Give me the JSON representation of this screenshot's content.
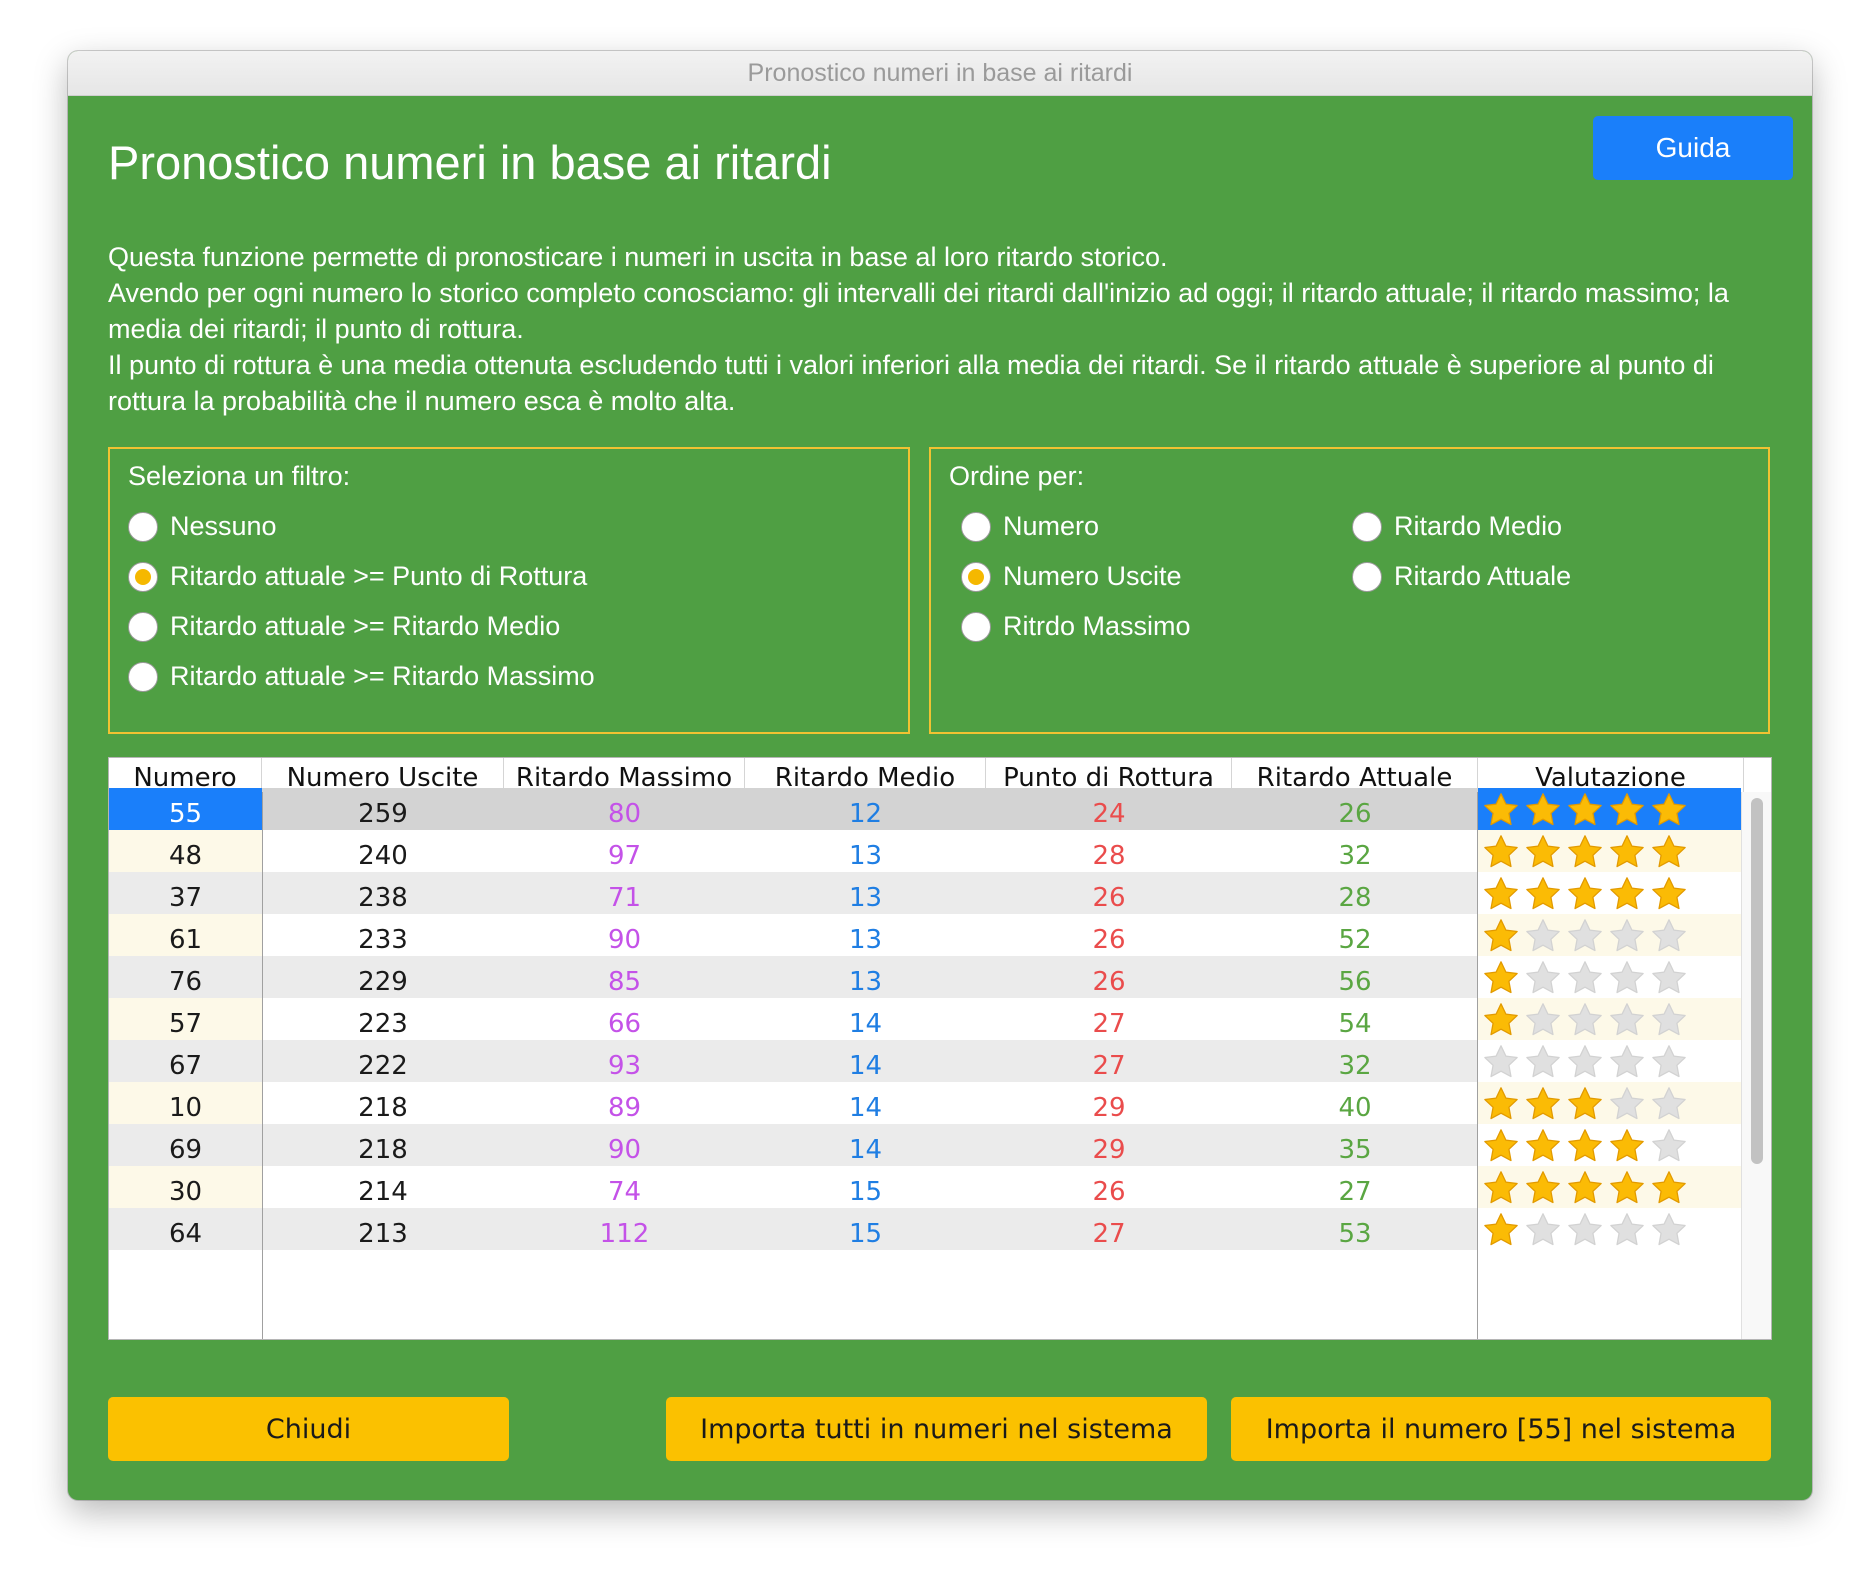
{
  "window": {
    "title": "Pronostico numeri in base ai ritardi"
  },
  "heading": "Pronostico numeri in base ai ritardi",
  "help_button": "Guida",
  "description": [
    "Questa funzione permette di pronosticare i numeri in uscita in base al loro ritardo storico.",
    "Avendo per ogni numero lo storico completo conosciamo: gli intervalli dei ritardi dall'inizio ad oggi; il ritardo attuale; il ritardo massimo; la media dei ritardi; il punto di rottura.",
    "Il punto di rottura è una media ottenuta escludendo tutti i valori inferiori alla media dei ritardi. Se il ritardo attuale è superiore al punto di rottura la probabilità che il numero esca è molto alta."
  ],
  "filter": {
    "title": "Seleziona un filtro:",
    "options": [
      {
        "label": "Nessuno",
        "selected": false
      },
      {
        "label": "Ritardo attuale >= Punto di Rottura",
        "selected": true
      },
      {
        "label": "Ritardo attuale >= Ritardo Medio",
        "selected": false
      },
      {
        "label": "Ritardo attuale >= Ritardo Massimo",
        "selected": false
      }
    ]
  },
  "order": {
    "title": "Ordine per:",
    "options": [
      {
        "label": "Numero",
        "selected": false
      },
      {
        "label": "Numero Uscite",
        "selected": true
      },
      {
        "label": "Ritrdo Massimo",
        "selected": false
      },
      {
        "label": "Ritardo Medio",
        "selected": false
      },
      {
        "label": "Ritardo Attuale",
        "selected": false
      }
    ]
  },
  "table": {
    "columns": [
      "Numero",
      "Numero Uscite",
      "Ritardo Massimo",
      "Ritardo Medio",
      "Punto di Rottura",
      "Ritardo Attuale",
      "Valutazione"
    ],
    "selected_row": 0,
    "rating_max": 5,
    "rows": [
      {
        "numero": "55",
        "uscite": "259",
        "massimo": "80",
        "medio": "12",
        "rottura": "24",
        "attuale": "26",
        "rating": 5
      },
      {
        "numero": "48",
        "uscite": "240",
        "massimo": "97",
        "medio": "13",
        "rottura": "28",
        "attuale": "32",
        "rating": 5
      },
      {
        "numero": "37",
        "uscite": "238",
        "massimo": "71",
        "medio": "13",
        "rottura": "26",
        "attuale": "28",
        "rating": 5
      },
      {
        "numero": "61",
        "uscite": "233",
        "massimo": "90",
        "medio": "13",
        "rottura": "26",
        "attuale": "52",
        "rating": 1
      },
      {
        "numero": "76",
        "uscite": "229",
        "massimo": "85",
        "medio": "13",
        "rottura": "26",
        "attuale": "56",
        "rating": 1
      },
      {
        "numero": "57",
        "uscite": "223",
        "massimo": "66",
        "medio": "14",
        "rottura": "27",
        "attuale": "54",
        "rating": 1
      },
      {
        "numero": "67",
        "uscite": "222",
        "massimo": "93",
        "medio": "14",
        "rottura": "27",
        "attuale": "32",
        "rating": 0
      },
      {
        "numero": "10",
        "uscite": "218",
        "massimo": "89",
        "medio": "14",
        "rottura": "29",
        "attuale": "40",
        "rating": 3
      },
      {
        "numero": "69",
        "uscite": "218",
        "massimo": "90",
        "medio": "14",
        "rottura": "29",
        "attuale": "35",
        "rating": 4
      },
      {
        "numero": "30",
        "uscite": "214",
        "massimo": "74",
        "medio": "15",
        "rottura": "26",
        "attuale": "27",
        "rating": 5
      },
      {
        "numero": "64",
        "uscite": "213",
        "massimo": "112",
        "medio": "15",
        "rottura": "27",
        "attuale": "53",
        "rating": 1
      }
    ]
  },
  "buttons": {
    "close": "Chiudi",
    "import_all": "Importa tutti in numeri nel sistema",
    "import_one": "Importa il numero [55] nel sistema"
  },
  "colors": {
    "background": "#4f9f43",
    "group_border": "#f1c232",
    "button_yellow": "#fbc100",
    "button_blue": "#1a7ffa",
    "selection": "#1a7ffa",
    "star_on": "#fbbb05",
    "star_off": "#e0e0e0",
    "max_text": "#c452e8",
    "medio_text": "#1f7ee3",
    "rottura_text": "#ea4c4c",
    "attuale_text": "#5aa642"
  }
}
